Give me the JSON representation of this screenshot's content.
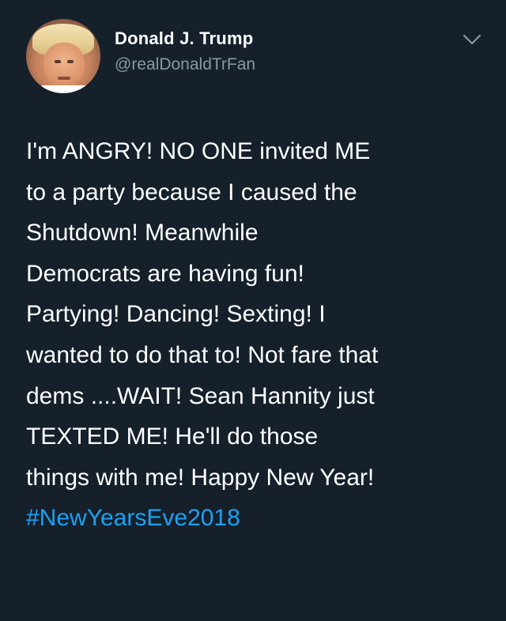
{
  "author": {
    "display_name": "Donald J. Trump",
    "handle": "@realDonaldTrFan"
  },
  "menu_icon": "chevron-down-icon",
  "tweet": {
    "lines": [
      "I'm ANGRY! NO ONE invited ME",
      "to a party because I caused the",
      "Shutdown! Meanwhile",
      "Democrats are having fun!",
      "Partying! Dancing! Sexting! I",
      "wanted to do that to! Not fare that",
      "dems ....WAIT! Sean Hannity just",
      "TEXTED ME! He'll do those",
      "things with me! Happy New Year!"
    ],
    "hashtag": "#NewYearsEve2018"
  },
  "colors": {
    "background": "#15202b",
    "text": "#ffffff",
    "secondary_text": "#8899a6",
    "link": "#1da1f2"
  }
}
